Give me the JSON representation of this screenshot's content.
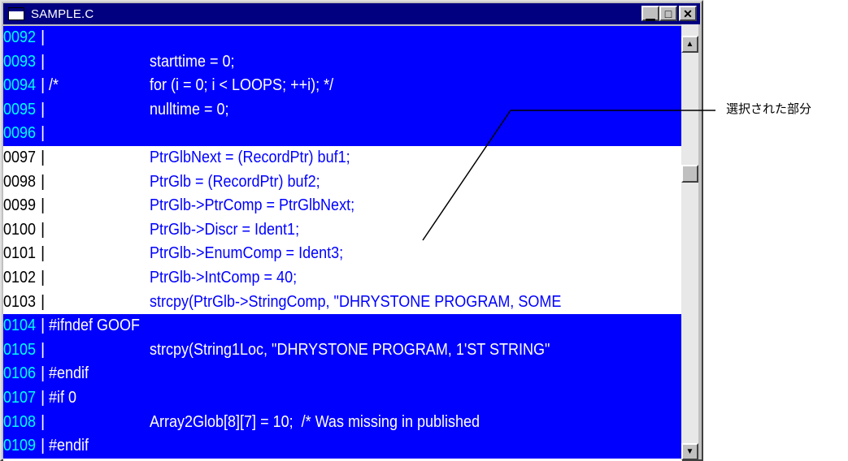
{
  "window": {
    "title": "SAMPLE.C",
    "controls": {
      "minimize": "▁",
      "maximize": "□",
      "close": "✕"
    }
  },
  "editor": {
    "lines": [
      {
        "num": "0092",
        "sep": "|",
        "pre": "",
        "code": "",
        "selected": true
      },
      {
        "num": "0093",
        "sep": "|",
        "pre": "",
        "code": "starttime = 0;",
        "selected": true
      },
      {
        "num": "0094",
        "sep": "|",
        "pre": "/*",
        "code": "for (i = 0; i < LOOPS; ++i); */",
        "selected": true
      },
      {
        "num": "0095",
        "sep": "|",
        "pre": "",
        "code": "nulltime = 0;",
        "selected": true
      },
      {
        "num": "0096",
        "sep": "|",
        "pre": "",
        "code": "",
        "selected": true
      },
      {
        "num": "0097",
        "sep": "|",
        "pre": "",
        "code": "PtrGlbNext = (RecordPtr) buf1;",
        "selected": false
      },
      {
        "num": "0098",
        "sep": "|",
        "pre": "",
        "code": "PtrGlb = (RecordPtr) buf2;",
        "selected": false
      },
      {
        "num": "0099",
        "sep": "|",
        "pre": "",
        "code": "PtrGlb->PtrComp = PtrGlbNext;",
        "selected": false
      },
      {
        "num": "0100",
        "sep": "|",
        "pre": "",
        "code": "PtrGlb->Discr = Ident1;",
        "selected": false
      },
      {
        "num": "0101",
        "sep": "|",
        "pre": "",
        "code": "PtrGlb->EnumComp = Ident3;",
        "selected": false
      },
      {
        "num": "0102",
        "sep": "|",
        "pre": "",
        "code": "PtrGlb->IntComp = 40;",
        "selected": false
      },
      {
        "num": "0103",
        "sep": "|",
        "pre": "",
        "code": "strcpy(PtrGlb->StringComp, \"DHRYSTONE PROGRAM, SOME",
        "selected": false
      },
      {
        "num": "0104",
        "sep": "|",
        "pre": "#ifndef GOOF",
        "code": "",
        "selected": true
      },
      {
        "num": "0105",
        "sep": "|",
        "pre": "",
        "code": "strcpy(String1Loc, \"DHRYSTONE PROGRAM, 1'ST STRING\"",
        "selected": true
      },
      {
        "num": "0106",
        "sep": "|",
        "pre": "#endif",
        "code": "",
        "selected": true
      },
      {
        "num": "0107",
        "sep": "|",
        "pre": "#if 0",
        "code": "",
        "selected": true
      },
      {
        "num": "0108",
        "sep": "|",
        "pre": "",
        "code": "Array2Glob[8][7] = 10;  /* Was missing in published",
        "selected": true
      },
      {
        "num": "0109",
        "sep": "|",
        "pre": "#endif",
        "code": "",
        "selected": true
      }
    ]
  },
  "scrollbar": {
    "up_arrow": "▲",
    "down_arrow": "▼",
    "thumb_position": 0.3
  },
  "annotation": {
    "label": "選択された部分"
  },
  "colors": {
    "selection_bg": "#0000ff",
    "selected_line_number": "#00ffff",
    "unselected_code": "#0000ff",
    "title_bar": "#000080"
  }
}
